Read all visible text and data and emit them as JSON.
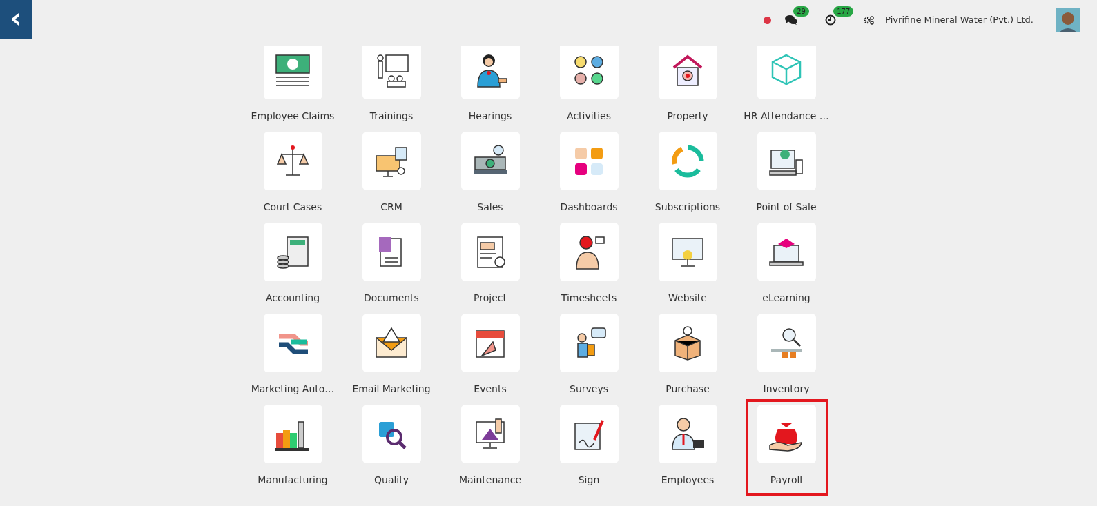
{
  "header": {
    "back_label": "‹",
    "messages_count": "29",
    "activities_count": "177",
    "company": "Pivrifine Mineral Water (Pvt.) Ltd."
  },
  "apps": [
    {
      "label": "Employee Claims",
      "highlighted": false
    },
    {
      "label": "Trainings",
      "highlighted": false
    },
    {
      "label": "Hearings",
      "highlighted": false
    },
    {
      "label": "Activities",
      "highlighted": false
    },
    {
      "label": "Property",
      "highlighted": false
    },
    {
      "label": "HR Attendance …",
      "highlighted": false
    },
    {
      "label": "Court Cases",
      "highlighted": false
    },
    {
      "label": "CRM",
      "highlighted": false
    },
    {
      "label": "Sales",
      "highlighted": false
    },
    {
      "label": "Dashboards",
      "highlighted": false
    },
    {
      "label": "Subscriptions",
      "highlighted": false
    },
    {
      "label": "Point of Sale",
      "highlighted": false
    },
    {
      "label": "Accounting",
      "highlighted": false
    },
    {
      "label": "Documents",
      "highlighted": false
    },
    {
      "label": "Project",
      "highlighted": false
    },
    {
      "label": "Timesheets",
      "highlighted": false
    },
    {
      "label": "Website",
      "highlighted": false
    },
    {
      "label": "eLearning",
      "highlighted": false
    },
    {
      "label": "Marketing Auto…",
      "highlighted": false
    },
    {
      "label": "Email Marketing",
      "highlighted": false
    },
    {
      "label": "Events",
      "highlighted": false
    },
    {
      "label": "Surveys",
      "highlighted": false
    },
    {
      "label": "Purchase",
      "highlighted": false
    },
    {
      "label": "Inventory",
      "highlighted": false
    },
    {
      "label": "Manufacturing",
      "highlighted": false
    },
    {
      "label": "Quality",
      "highlighted": false
    },
    {
      "label": "Maintenance",
      "highlighted": false
    },
    {
      "label": "Sign",
      "highlighted": false
    },
    {
      "label": "Employees",
      "highlighted": false
    },
    {
      "label": "Payroll",
      "highlighted": true
    }
  ]
}
